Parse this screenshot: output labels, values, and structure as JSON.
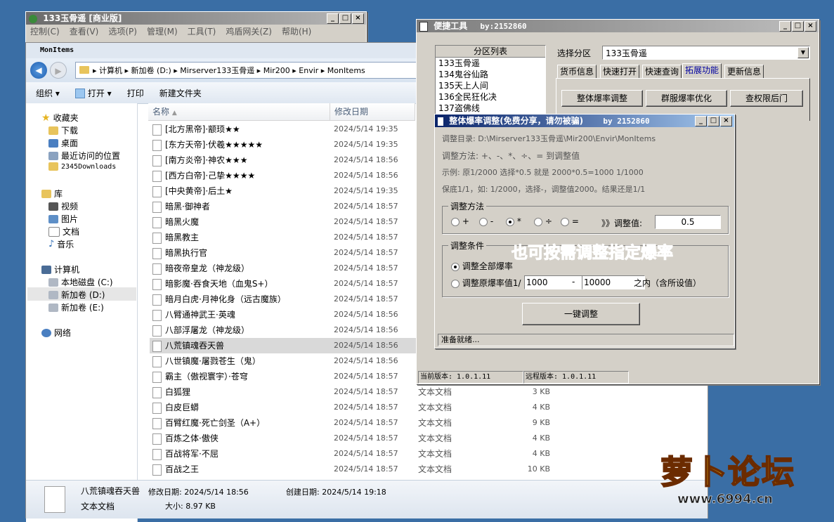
{
  "main_window": {
    "title": "133玉骨遥 [商业版]",
    "menu": [
      "控制(C)",
      "查看(V)",
      "选项(P)",
      "管理(M)",
      "工具(T)",
      "鸡盾网关(Z)",
      "帮助(H)"
    ]
  },
  "explorer": {
    "title": "MonItems",
    "breadcrumb": "▸ 计算机 ▸ 新加卷 (D:) ▸ Mirserver133玉骨遥 ▸ Mir200 ▸ Envir ▸ MonItems",
    "commands": [
      "组织 ▾",
      "打开 ▾",
      "打印",
      "新建文件夹"
    ],
    "nav": {
      "favorites": "收藏夹",
      "fav_items": [
        "下载",
        "桌面",
        "最近访问的位置",
        "2345Downloads"
      ],
      "library": "库",
      "lib_items": [
        "视频",
        "图片",
        "文档",
        "音乐"
      ],
      "computer": "计算机",
      "comp_items": [
        "本地磁盘 (C:)",
        "新加卷 (D:)",
        "新加卷 (E:)"
      ],
      "network": "网络"
    },
    "columns": {
      "name": "名称",
      "date": "修改日期"
    },
    "files": [
      {
        "name": "[北方黑帝]·颛顼★★",
        "date": "2024/5/14 19:35",
        "type": "",
        "size": ""
      },
      {
        "name": "[东方天帝]·伏羲★★★★★",
        "date": "2024/5/14 19:35",
        "type": "",
        "size": ""
      },
      {
        "name": "[南方炎帝]·神农★★★",
        "date": "2024/5/14 18:56",
        "type": "",
        "size": ""
      },
      {
        "name": "[西方白帝]·己挚★★★★",
        "date": "2024/5/14 18:56",
        "type": "",
        "size": ""
      },
      {
        "name": "[中央黄帝]·后土★",
        "date": "2024/5/14 19:35",
        "type": "",
        "size": ""
      },
      {
        "name": "暗黑·御神者",
        "date": "2024/5/14 18:57",
        "type": "",
        "size": ""
      },
      {
        "name": "暗黑火魔",
        "date": "2024/5/14 18:57",
        "type": "",
        "size": ""
      },
      {
        "name": "暗黑教主",
        "date": "2024/5/14 18:57",
        "type": "",
        "size": ""
      },
      {
        "name": "暗黑执行官",
        "date": "2024/5/14 18:57",
        "type": "",
        "size": ""
      },
      {
        "name": "暗夜帝皇龙（神龙级）",
        "date": "2024/5/14 18:57",
        "type": "",
        "size": ""
      },
      {
        "name": "暗影魔·吞食天地（血鬼S+）",
        "date": "2024/5/14 18:57",
        "type": "",
        "size": ""
      },
      {
        "name": "暗月白虎·月神化身（远古魔族）",
        "date": "2024/5/14 18:57",
        "type": "",
        "size": ""
      },
      {
        "name": "八臂通神武王·英魂",
        "date": "2024/5/14 18:56",
        "type": "",
        "size": ""
      },
      {
        "name": "八部浮屠龙（神龙级）",
        "date": "2024/5/14 18:56",
        "type": "",
        "size": ""
      },
      {
        "name": "八荒镇魂吞天兽",
        "date": "2024/5/14 18:56",
        "type": "",
        "size": "",
        "selected": true
      },
      {
        "name": "八世镇魔·屠戮苍生（鬼）",
        "date": "2024/5/14 18:56",
        "type": "",
        "size": ""
      },
      {
        "name": "霸主（傲视寰宇）·苍穹",
        "date": "2024/5/14 18:57",
        "type": "",
        "size": ""
      },
      {
        "name": "白狐狸",
        "date": "2024/5/14 18:57",
        "type": "文本文档",
        "size": "3 KB"
      },
      {
        "name": "白皮巨蟒",
        "date": "2024/5/14 18:57",
        "type": "文本文档",
        "size": "4 KB"
      },
      {
        "name": "百臂红魔·死亡剑圣（A+）",
        "date": "2024/5/14 18:57",
        "type": "文本文档",
        "size": "9 KB"
      },
      {
        "name": "百炼之体·傲侠",
        "date": "2024/5/14 18:57",
        "type": "文本文档",
        "size": "4 KB"
      },
      {
        "name": "百战将军·不屈",
        "date": "2024/5/14 18:57",
        "type": "文本文档",
        "size": "4 KB"
      },
      {
        "name": "百战之王",
        "date": "2024/5/14 18:57",
        "type": "文本文档",
        "size": "10 KB"
      }
    ],
    "details": {
      "name": "八荒镇魂吞天兽",
      "type": "文本文档",
      "modified": "修改日期: 2024/5/14 18:56",
      "created": "创建日期: 2024/5/14 19:18",
      "size": "大小: 8.97 KB"
    }
  },
  "tools": {
    "title": "便捷工具",
    "by": "by:2152860",
    "partition_header": "分区列表",
    "partitions": [
      "133玉骨遥",
      "134鬼谷仙路",
      "135天上人间",
      "136全民狂化决",
      "137盗佛线"
    ],
    "select_label": "选择分区",
    "selected_partition": "133玉骨遥",
    "tabs": [
      "货币信息",
      "快速打开",
      "快速查询",
      "拓展功能",
      "更新信息"
    ],
    "buttons": [
      "整体爆率调整",
      "群服爆率优化",
      "查权限后门"
    ],
    "local_version": "当前版本: 1.0.1.11",
    "remote_version": "远程版本: 1.0.1.11"
  },
  "dialog": {
    "title": "整体爆率调整(免费分享，请勿被骗)",
    "by": "by 2152860",
    "lines": [
      "调整目录: D:\\Mirserver133玉骨遥\\Mir200\\Envir\\MonItems",
      "调整方法: +、-、*、÷、=  到调整值",
      "示例: 原1/2000 选择*0.5 就是 2000*0.5=1000  1/1000",
      "保底1/1，如: 1/2000，选择-，调整值2000。结果还是1/1"
    ],
    "method_label": "调整方法",
    "methods": [
      "+",
      "-",
      "*",
      "÷",
      "="
    ],
    "value_label": "》》调整值:",
    "value": "0.5",
    "cond_label": "调整条件",
    "cond_all": "调整全部爆率",
    "cond_range": "调整原爆率值1/",
    "range_from": "1000",
    "range_dash": "-",
    "range_to": "10000",
    "range_suffix": "之内（含所设值）",
    "action": "一键调整",
    "status": "准备就绪...",
    "overlay": "也可按需调整指定爆率"
  },
  "watermark": {
    "text": "萝卜论坛",
    "url": "www.6994.cn"
  }
}
